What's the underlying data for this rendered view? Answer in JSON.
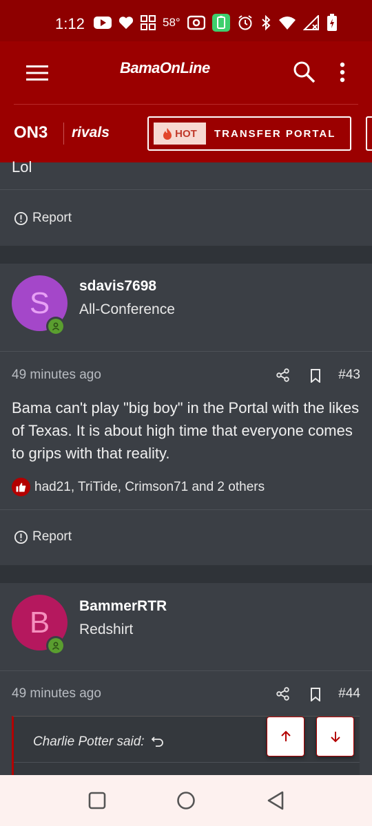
{
  "status_bar": {
    "time": "1:12",
    "temperature": "58°"
  },
  "header": {
    "brand": "BamaOnLine",
    "on3_logo": "ON3",
    "rivals_logo": "rivals",
    "hot_label": "HOT",
    "portal_label": "TRANSFER PORTAL"
  },
  "prev_post": {
    "text_fragment": "Lol",
    "report_label": "Report"
  },
  "posts": [
    {
      "avatar_letter": "S",
      "avatar_color": "#a447c9",
      "avatar_text_color": "#e7a0f5",
      "username": "sdavis7698",
      "rank": "All-Conference",
      "time": "49 minutes ago",
      "number": "#43",
      "body": "Bama can't play \"big boy\" in the Portal with the likes of Texas. It is about high time that everyone comes to grips with that reality.",
      "likes": "had21, TriTide, Crimson71 and 2 others",
      "report_label": "Report"
    },
    {
      "avatar_letter": "B",
      "avatar_color": "#b5185e",
      "avatar_text_color": "#f590be",
      "username": "BammerRTR",
      "rank": "Redshirt",
      "time": "49 minutes ago",
      "number": "#44",
      "quote_author": "Charlie Potter said:"
    }
  ],
  "colors": {
    "brand_red": "#9b0000",
    "background": "#2f3338",
    "card": "#3b3f45",
    "online_badge": "#5a9e2f"
  }
}
